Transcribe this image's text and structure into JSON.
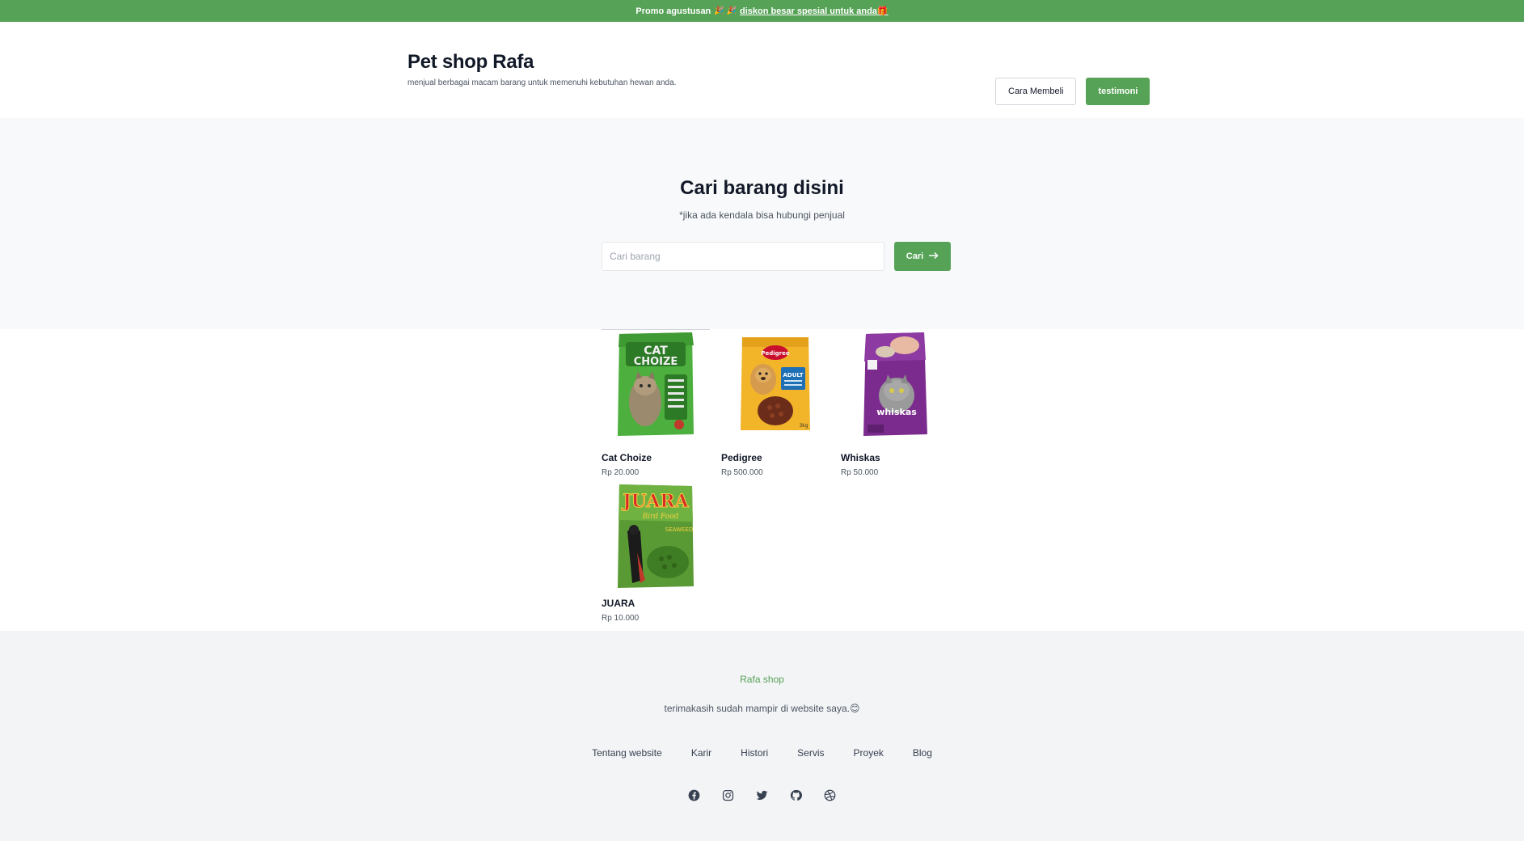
{
  "promo": {
    "prefix": "Promo agustusan",
    "emojis": "🎉 🎉",
    "link_text": "diskon besar spesial untuk anda",
    "link_emoji": "🎁"
  },
  "header": {
    "title": "Pet shop Rafa",
    "subtitle": "menjual berbagai macam barang untuk memenuhi kebutuhan hewan anda.",
    "btn_cara": "Cara Membeli",
    "btn_testimoni": "testimoni"
  },
  "search": {
    "title": "Cari barang disini",
    "note": "*jika ada kendala bisa hubungi penjual",
    "placeholder": "Cari barang",
    "value": "",
    "button": "Cari",
    "button_icon": "→"
  },
  "products": [
    {
      "name": "Cat Choize",
      "price": "Rp 20.000",
      "image": "cat-choize-package"
    },
    {
      "name": "Pedigree",
      "price": "Rp 500.000",
      "image": "pedigree-package"
    },
    {
      "name": "Whiskas",
      "price": "Rp 50.000",
      "image": "whiskas-package"
    },
    {
      "name": "JUARA",
      "price": "Rp 10.000",
      "image": "juara-bird-food-package"
    }
  ],
  "footer": {
    "brand": "Rafa shop",
    "thanks": "terimakasih sudah mampir di website saya.",
    "thanks_emoji": "😊",
    "links": [
      "Tentang website",
      "Karir",
      "Histori",
      "Servis",
      "Proyek",
      "Blog"
    ],
    "social_icons": [
      "facebook-icon",
      "instagram-icon",
      "twitter-icon",
      "github-icon",
      "dribbble-icon"
    ]
  },
  "colors": {
    "accent": "#56a257",
    "heading": "#111827",
    "muted": "#4b5563",
    "section_bg": "#f8f9fa",
    "footer_bg": "#f3f4f6"
  }
}
